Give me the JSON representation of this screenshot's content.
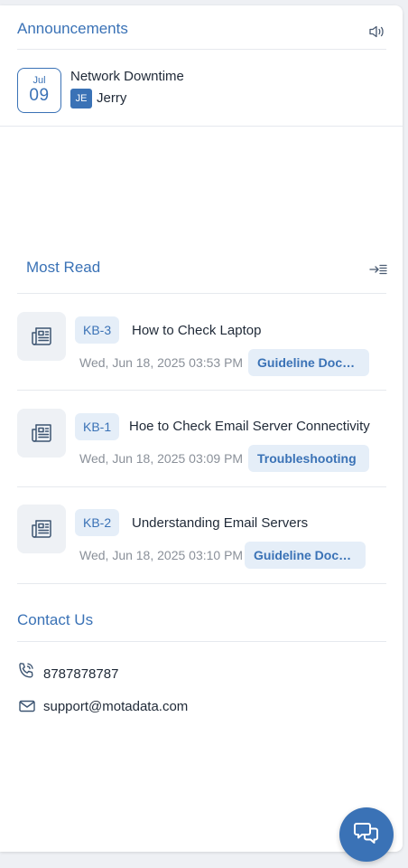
{
  "announcements": {
    "title": "Announcements",
    "items": [
      {
        "month": "Jul",
        "day": "09",
        "title": "Network Downtime",
        "initials": "JE",
        "user": "Jerry"
      }
    ]
  },
  "most_read": {
    "title": "Most Read",
    "items": [
      {
        "id": "KB-3",
        "title": "How to Check Laptop",
        "date": "Wed, Jun 18, 2025 03:53 PM",
        "tag": "Guideline Documents"
      },
      {
        "id": "KB-1",
        "title": "Hoe to Check Email Server Connectivity",
        "date": "Wed, Jun 18, 2025 03:09 PM",
        "tag": "Troubleshooting"
      },
      {
        "id": "KB-2",
        "title": "Understanding Email Servers",
        "date": "Wed, Jun 18, 2025 03:10 PM",
        "tag": "Guideline Documents"
      }
    ]
  },
  "contact": {
    "title": "Contact Us",
    "phone": "8787878787",
    "email": "support@motadata.com"
  },
  "icons": {
    "announcement": "speaker-icon",
    "expand": "expand-list-icon",
    "article": "newspaper-icon",
    "phone": "phone-icon",
    "email": "mail-icon",
    "chat": "chat-icon"
  },
  "colors": {
    "accent": "#3a72b6",
    "chip_bg": "#e5eef8",
    "muted": "#8a9099"
  }
}
